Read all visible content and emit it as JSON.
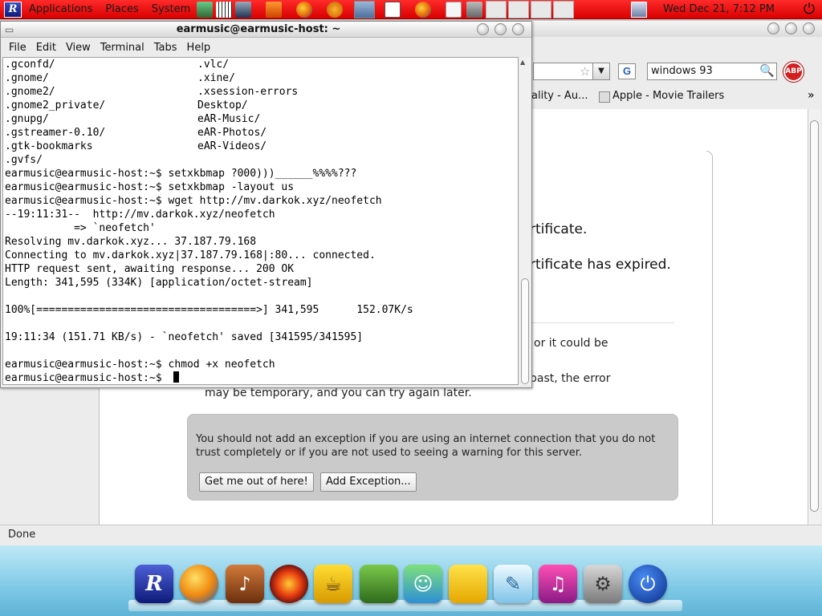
{
  "top_panel": {
    "menus": [
      "Applications",
      "Places",
      "System"
    ],
    "clock": "Wed Dec 21,  7:12 PM"
  },
  "browser": {
    "search_query": "windows 93",
    "search_engine_letter": "G",
    "adblock_label": "ABP",
    "bookmarks": [
      "eality - Au...",
      "Apple - Movie Trailers"
    ],
    "content_fragments": [
      "rtificate.",
      "rtificate has expired.",
      "or it could be",
      "past, the error",
      "may be temporary, and you can try again later."
    ],
    "warning_text": "You should not add an exception if you are using an internet connection that you do not trust completely or if you are not used to seeing a warning for this server.",
    "button_get_out": "Get me out of here!",
    "button_add_exception": "Add Exception...",
    "status": "Done"
  },
  "terminal": {
    "title": "earmusic@earmusic-host: ~",
    "menus": [
      "File",
      "Edit",
      "View",
      "Terminal",
      "Tabs",
      "Help"
    ],
    "listing_left": [
      ".gconfd/",
      ".gnome/",
      ".gnome2/",
      ".gnome2_private/",
      ".gnupg/",
      ".gstreamer-0.10/",
      ".gtk-bookmarks",
      ".gvfs/"
    ],
    "listing_right": [
      ".vlc/",
      ".xine/",
      ".xsession-errors",
      "Desktop/",
      "eAR-Music/",
      "eAR-Photos/",
      "eAR-Videos/"
    ],
    "lines": [
      "earmusic@earmusic-host:~$ setxkbmap ?000)))______%%%%???",
      "earmusic@earmusic-host:~$ setxkbmap -layout us",
      "earmusic@earmusic-host:~$ wget http://mv.darkok.xyz/neofetch",
      "--19:11:31--  http://mv.darkok.xyz/neofetch",
      "           => `neofetch'",
      "Resolving mv.darkok.xyz... 37.187.79.168",
      "Connecting to mv.darkok.xyz|37.187.79.168|:80... connected.",
      "HTTP request sent, awaiting response... 200 OK",
      "Length: 341,595 (334K) [application/octet-stream]",
      "",
      "100%[===================================>] 341,595      152.07K/s",
      "",
      "19:11:34 (151.71 KB/s) - `neofetch' saved [341595/341595]",
      "",
      "earmusic@earmusic-host:~$ chmod +x neofetch",
      "earmusic@earmusic-host:~$ "
    ]
  },
  "dock": {
    "items": [
      "app-menu-icon",
      "firefox-icon",
      "guitar-icon",
      "burner-icon",
      "coffee-icon",
      "image-editor-icon",
      "messenger-icon",
      "office-icon",
      "drawing-icon",
      "music-icon",
      "settings-icon",
      "power-icon"
    ]
  },
  "colors": {
    "panel_red": "#e00000",
    "dock_blue": "#7fc9e6"
  }
}
